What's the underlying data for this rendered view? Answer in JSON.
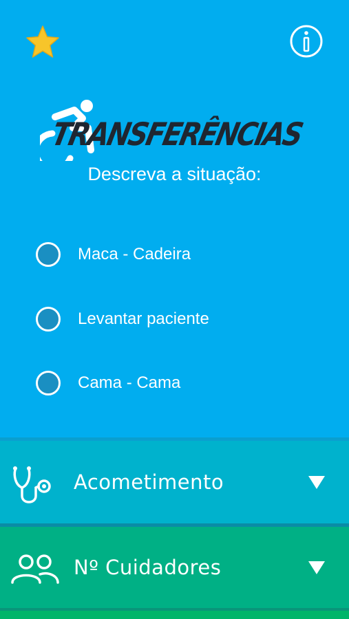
{
  "header": {
    "favorite_icon": "star-icon",
    "info_icon": "info-icon",
    "colors": {
      "star": "#f7c52a",
      "background": "#01adef"
    }
  },
  "logo": {
    "icon": "accessibility-wheelchair-icon",
    "text": "TRANSFERÊNCIAS"
  },
  "prompt": "Descreva a situação:",
  "options": [
    {
      "label": "Maca - Cadeira"
    },
    {
      "label": "Levantar paciente"
    },
    {
      "label": "Cama - Cama"
    }
  ],
  "sections": [
    {
      "label": "Acometimento",
      "icon": "stethoscope-icon",
      "color": "#00b2cd"
    },
    {
      "label": "Nº Cuidadores",
      "icon": "users-icon",
      "color": "#00b085"
    }
  ]
}
